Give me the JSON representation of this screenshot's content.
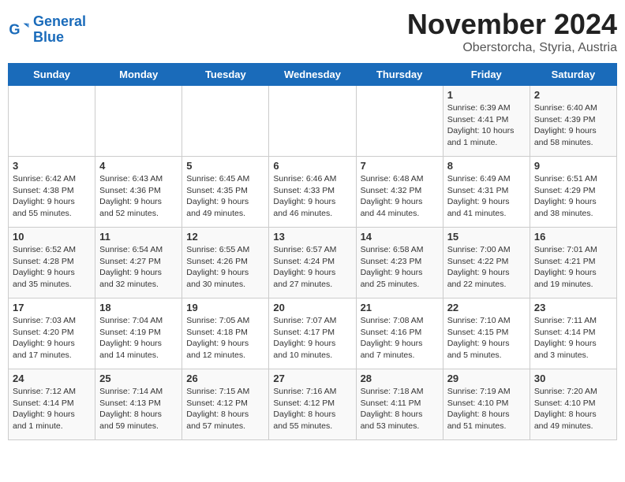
{
  "logo": {
    "line1": "General",
    "line2": "Blue"
  },
  "title": "November 2024",
  "subtitle": "Oberstorcha, Styria, Austria",
  "headers": [
    "Sunday",
    "Monday",
    "Tuesday",
    "Wednesday",
    "Thursday",
    "Friday",
    "Saturday"
  ],
  "weeks": [
    [
      {
        "day": "",
        "info": ""
      },
      {
        "day": "",
        "info": ""
      },
      {
        "day": "",
        "info": ""
      },
      {
        "day": "",
        "info": ""
      },
      {
        "day": "",
        "info": ""
      },
      {
        "day": "1",
        "info": "Sunrise: 6:39 AM\nSunset: 4:41 PM\nDaylight: 10 hours and 1 minute."
      },
      {
        "day": "2",
        "info": "Sunrise: 6:40 AM\nSunset: 4:39 PM\nDaylight: 9 hours and 58 minutes."
      }
    ],
    [
      {
        "day": "3",
        "info": "Sunrise: 6:42 AM\nSunset: 4:38 PM\nDaylight: 9 hours and 55 minutes."
      },
      {
        "day": "4",
        "info": "Sunrise: 6:43 AM\nSunset: 4:36 PM\nDaylight: 9 hours and 52 minutes."
      },
      {
        "day": "5",
        "info": "Sunrise: 6:45 AM\nSunset: 4:35 PM\nDaylight: 9 hours and 49 minutes."
      },
      {
        "day": "6",
        "info": "Sunrise: 6:46 AM\nSunset: 4:33 PM\nDaylight: 9 hours and 46 minutes."
      },
      {
        "day": "7",
        "info": "Sunrise: 6:48 AM\nSunset: 4:32 PM\nDaylight: 9 hours and 44 minutes."
      },
      {
        "day": "8",
        "info": "Sunrise: 6:49 AM\nSunset: 4:31 PM\nDaylight: 9 hours and 41 minutes."
      },
      {
        "day": "9",
        "info": "Sunrise: 6:51 AM\nSunset: 4:29 PM\nDaylight: 9 hours and 38 minutes."
      }
    ],
    [
      {
        "day": "10",
        "info": "Sunrise: 6:52 AM\nSunset: 4:28 PM\nDaylight: 9 hours and 35 minutes."
      },
      {
        "day": "11",
        "info": "Sunrise: 6:54 AM\nSunset: 4:27 PM\nDaylight: 9 hours and 32 minutes."
      },
      {
        "day": "12",
        "info": "Sunrise: 6:55 AM\nSunset: 4:26 PM\nDaylight: 9 hours and 30 minutes."
      },
      {
        "day": "13",
        "info": "Sunrise: 6:57 AM\nSunset: 4:24 PM\nDaylight: 9 hours and 27 minutes."
      },
      {
        "day": "14",
        "info": "Sunrise: 6:58 AM\nSunset: 4:23 PM\nDaylight: 9 hours and 25 minutes."
      },
      {
        "day": "15",
        "info": "Sunrise: 7:00 AM\nSunset: 4:22 PM\nDaylight: 9 hours and 22 minutes."
      },
      {
        "day": "16",
        "info": "Sunrise: 7:01 AM\nSunset: 4:21 PM\nDaylight: 9 hours and 19 minutes."
      }
    ],
    [
      {
        "day": "17",
        "info": "Sunrise: 7:03 AM\nSunset: 4:20 PM\nDaylight: 9 hours and 17 minutes."
      },
      {
        "day": "18",
        "info": "Sunrise: 7:04 AM\nSunset: 4:19 PM\nDaylight: 9 hours and 14 minutes."
      },
      {
        "day": "19",
        "info": "Sunrise: 7:05 AM\nSunset: 4:18 PM\nDaylight: 9 hours and 12 minutes."
      },
      {
        "day": "20",
        "info": "Sunrise: 7:07 AM\nSunset: 4:17 PM\nDaylight: 9 hours and 10 minutes."
      },
      {
        "day": "21",
        "info": "Sunrise: 7:08 AM\nSunset: 4:16 PM\nDaylight: 9 hours and 7 minutes."
      },
      {
        "day": "22",
        "info": "Sunrise: 7:10 AM\nSunset: 4:15 PM\nDaylight: 9 hours and 5 minutes."
      },
      {
        "day": "23",
        "info": "Sunrise: 7:11 AM\nSunset: 4:14 PM\nDaylight: 9 hours and 3 minutes."
      }
    ],
    [
      {
        "day": "24",
        "info": "Sunrise: 7:12 AM\nSunset: 4:14 PM\nDaylight: 9 hours and 1 minute."
      },
      {
        "day": "25",
        "info": "Sunrise: 7:14 AM\nSunset: 4:13 PM\nDaylight: 8 hours and 59 minutes."
      },
      {
        "day": "26",
        "info": "Sunrise: 7:15 AM\nSunset: 4:12 PM\nDaylight: 8 hours and 57 minutes."
      },
      {
        "day": "27",
        "info": "Sunrise: 7:16 AM\nSunset: 4:12 PM\nDaylight: 8 hours and 55 minutes."
      },
      {
        "day": "28",
        "info": "Sunrise: 7:18 AM\nSunset: 4:11 PM\nDaylight: 8 hours and 53 minutes."
      },
      {
        "day": "29",
        "info": "Sunrise: 7:19 AM\nSunset: 4:10 PM\nDaylight: 8 hours and 51 minutes."
      },
      {
        "day": "30",
        "info": "Sunrise: 7:20 AM\nSunset: 4:10 PM\nDaylight: 8 hours and 49 minutes."
      }
    ]
  ]
}
